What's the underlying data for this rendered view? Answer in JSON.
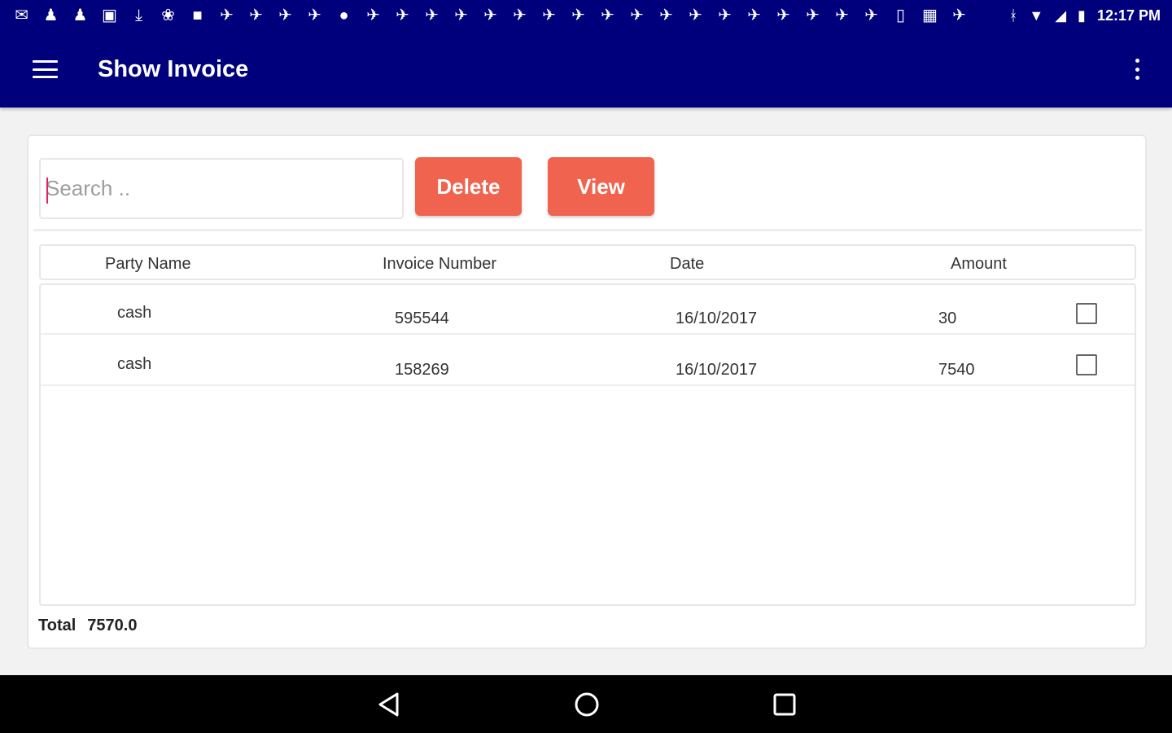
{
  "status_bar": {
    "time": "12:17 PM",
    "notification_icons": [
      "✉",
      "♟",
      "♟",
      "▣",
      "⤓",
      "❀",
      "■",
      "✈",
      "✈",
      "✈",
      "✈",
      "●",
      "✈",
      "✈",
      "✈",
      "✈",
      "✈",
      "✈",
      "✈",
      "✈",
      "✈",
      "✈",
      "✈",
      "✈",
      "✈",
      "✈",
      "✈",
      "✈",
      "✈",
      "✈",
      "▯",
      "▦",
      "✈"
    ],
    "bluetooth": "ᚼ",
    "wifi": "▼",
    "signal": "◢",
    "battery": "▮"
  },
  "app_bar": {
    "title": "Show Invoice"
  },
  "search": {
    "placeholder": "Search ..",
    "value": ""
  },
  "buttons": {
    "delete_label": "Delete",
    "view_label": "View"
  },
  "table": {
    "columns": [
      "Party Name",
      "Invoice Number",
      "Date",
      "Amount"
    ],
    "rows": [
      {
        "party": "cash",
        "invoice": "595544",
        "date": "16/10/2017",
        "amount": "30",
        "checked": false
      },
      {
        "party": "cash",
        "invoice": "158269",
        "date": "16/10/2017",
        "amount": "7540",
        "checked": false
      }
    ]
  },
  "footer": {
    "total_label": "Total",
    "total_value": "7570.0"
  },
  "colors": {
    "primary": "#00007d",
    "accent": "#f0634f",
    "nav_bar": "#000000"
  }
}
